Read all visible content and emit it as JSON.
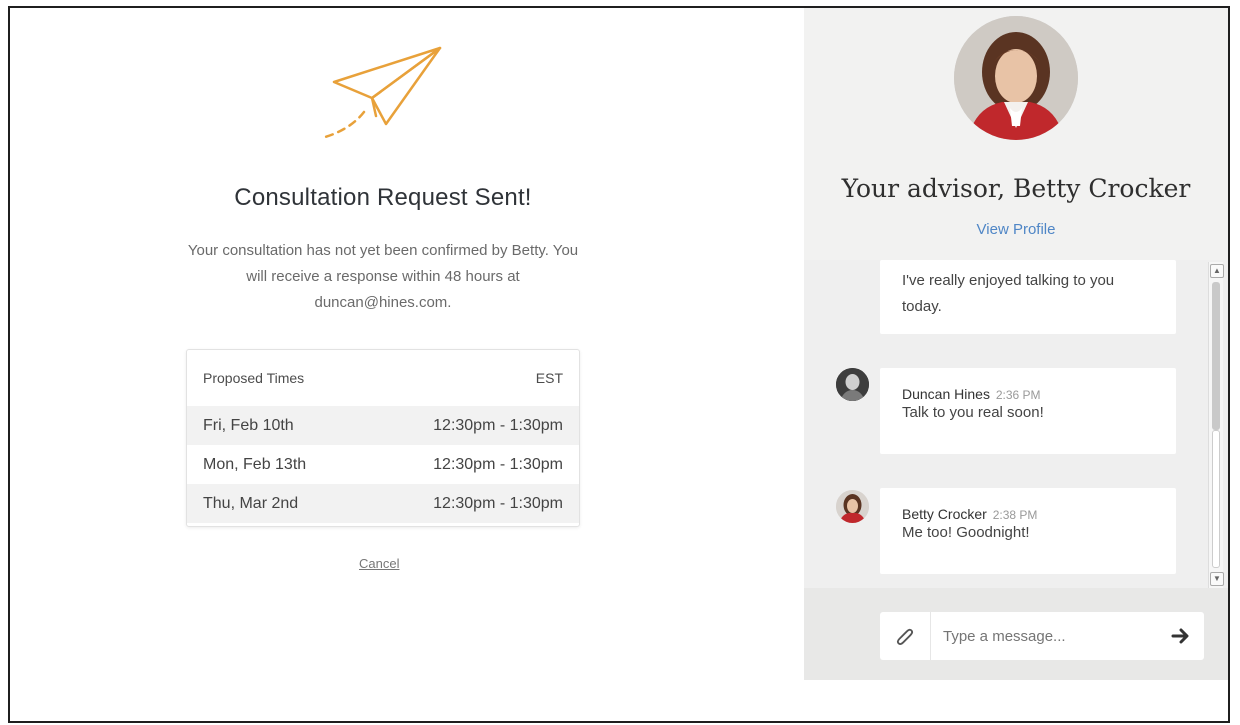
{
  "confirmation": {
    "title": "Consultation Request Sent!",
    "message": "Your consultation has not yet been confirmed by Betty. You will receive a response within 48 hours at duncan@hines.com.",
    "times": {
      "header_label": "Proposed Times",
      "timezone": "EST",
      "rows": [
        {
          "date": "Fri, Feb 10th",
          "time": "12:30pm - 1:30pm"
        },
        {
          "date": "Mon, Feb 13th",
          "time": "12:30pm - 1:30pm"
        },
        {
          "date": "Thu, Mar 2nd",
          "time": "12:30pm - 1:30pm"
        }
      ]
    },
    "cancel_label": "Cancel"
  },
  "advisor": {
    "name": "Your advisor, Betty Crocker",
    "view_profile": "View Profile"
  },
  "chat": {
    "messages": [
      {
        "text": "I've really enjoyed talking to you today."
      },
      {
        "sender": "Duncan Hines",
        "time": "2:36 PM",
        "text": "Talk to you real soon!"
      },
      {
        "sender": "Betty Crocker",
        "time": "2:38 PM",
        "text": "Me too! Goodnight!"
      }
    ],
    "input_placeholder": "Type a message...",
    "icons": {
      "attach": "paperclip-icon",
      "send": "arrow-right-icon"
    }
  },
  "colors": {
    "accent_orange": "#e8a13a",
    "link_blue": "#4f86c6"
  }
}
